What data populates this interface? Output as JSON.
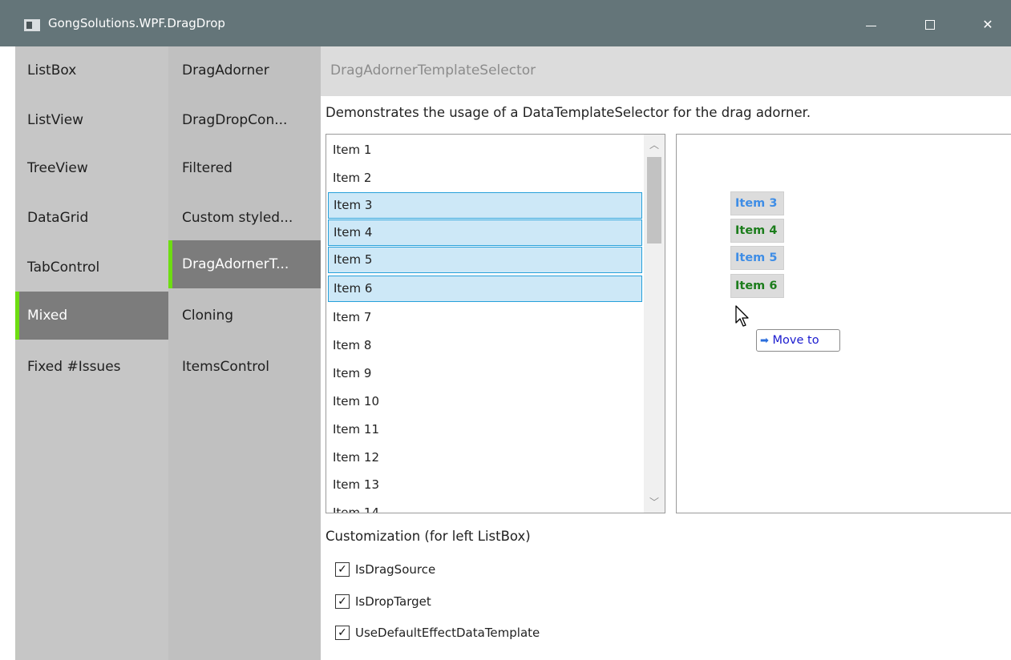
{
  "window": {
    "title": "GongSolutions.WPF.DragDrop"
  },
  "nav": {
    "column1": [
      {
        "label": "ListBox",
        "active": false
      },
      {
        "label": "ListView",
        "active": false
      },
      {
        "label": "TreeView",
        "active": false
      },
      {
        "label": "DataGrid",
        "active": false
      },
      {
        "label": "TabControl",
        "active": false
      },
      {
        "label": "Mixed",
        "active": true
      },
      {
        "label": "Fixed #Issues",
        "active": false
      }
    ],
    "column2": [
      {
        "label": "DragAdorner",
        "active": false
      },
      {
        "label": "DragDropCon...",
        "active": false
      },
      {
        "label": "Filtered",
        "active": false
      },
      {
        "label": "Custom styled...",
        "active": false
      },
      {
        "label": "DragAdornerT...",
        "active": true
      },
      {
        "label": "Cloning",
        "active": false
      },
      {
        "label": "ItemsControl",
        "active": false
      }
    ]
  },
  "content": {
    "header": "DragAdornerTemplateSelector",
    "description": "Demonstrates the usage of a DataTemplateSelector for the drag adorner.",
    "listbox_items": [
      {
        "label": "Item 1",
        "selected": false
      },
      {
        "label": "Item 2",
        "selected": false
      },
      {
        "label": "Item 3",
        "selected": true
      },
      {
        "label": "Item 4",
        "selected": true
      },
      {
        "label": "Item 5",
        "selected": true
      },
      {
        "label": "Item 6",
        "selected": true
      },
      {
        "label": "Item 7",
        "selected": false
      },
      {
        "label": "Item 8",
        "selected": false
      },
      {
        "label": "Item 9",
        "selected": false
      },
      {
        "label": "Item 10",
        "selected": false
      },
      {
        "label": "Item 11",
        "selected": false
      },
      {
        "label": "Item 12",
        "selected": false
      },
      {
        "label": "Item 13",
        "selected": false
      },
      {
        "label": "Item 14",
        "selected": false
      }
    ],
    "drag_adorner_items": [
      {
        "label": "Item 3",
        "color": "#3e8de6"
      },
      {
        "label": "Item 4",
        "color": "#1c7d1c"
      },
      {
        "label": "Item 5",
        "color": "#3e8de6"
      },
      {
        "label": "Item 6",
        "color": "#1c7d1c"
      }
    ],
    "drop_effect": {
      "label": "Move to",
      "icon": "arrow-right-icon"
    },
    "customization_title": "Customization (for left ListBox)",
    "checkboxes": [
      {
        "label": "IsDragSource",
        "checked": true
      },
      {
        "label": "IsDropTarget",
        "checked": true
      },
      {
        "label": "UseDefaultEffectDataTemplate",
        "checked": true
      }
    ]
  },
  "colors": {
    "titlebar": "#647579",
    "nav_active_accent": "#6edd12",
    "selection_fill": "#cde8f7",
    "selection_border": "#26a0da"
  }
}
